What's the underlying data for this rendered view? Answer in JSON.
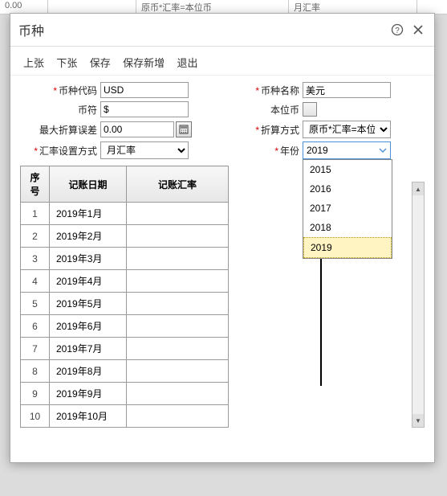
{
  "bg": {
    "c1": "0.00",
    "c2": "原币*汇率=本位币",
    "c3": "月汇率"
  },
  "dialog": {
    "title": "币种",
    "toolbar": {
      "prev": "上张",
      "next": "下张",
      "save": "保存",
      "saveNew": "保存新增",
      "exit": "退出"
    }
  },
  "fields": {
    "codeLabel": "币种代码",
    "code": "USD",
    "nameLabel": "币种名称",
    "name": "美元",
    "symbolLabel": "币符",
    "symbol": "$",
    "stdLabel": "本位币",
    "maxDiffLabel": "最大折算误差",
    "maxDiff": "0.00",
    "calcMethodLabel": "折算方式",
    "calcMethod": "原币*汇率=本位币",
    "rateModeLabel": "汇率设置方式",
    "rateMode": "月汇率",
    "yearLabel": "年份",
    "year": "2019",
    "yearOptions": [
      "2015",
      "2016",
      "2017",
      "2018",
      "2019"
    ]
  },
  "grid": {
    "h_idx": "序号",
    "h_date": "记账日期",
    "h_rate": "记账汇率",
    "rows": [
      {
        "idx": "1",
        "date": "2019年1月",
        "rate": ""
      },
      {
        "idx": "2",
        "date": "2019年2月",
        "rate": ""
      },
      {
        "idx": "3",
        "date": "2019年3月",
        "rate": ""
      },
      {
        "idx": "4",
        "date": "2019年4月",
        "rate": ""
      },
      {
        "idx": "5",
        "date": "2019年5月",
        "rate": ""
      },
      {
        "idx": "6",
        "date": "2019年6月",
        "rate": ""
      },
      {
        "idx": "7",
        "date": "2019年7月",
        "rate": ""
      },
      {
        "idx": "8",
        "date": "2019年8月",
        "rate": ""
      },
      {
        "idx": "9",
        "date": "2019年9月",
        "rate": ""
      },
      {
        "idx": "10",
        "date": "2019年10月",
        "rate": ""
      }
    ]
  }
}
